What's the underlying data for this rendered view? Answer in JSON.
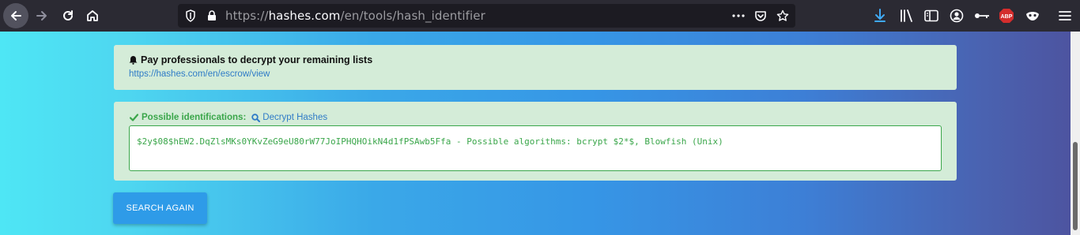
{
  "browser": {
    "url_scheme": "https://",
    "url_host": "hashes.com",
    "url_path": "/en/tools/hash_identifier",
    "icons": {
      "back": "arrow-left-icon",
      "forward": "arrow-right-icon",
      "reload": "reload-icon",
      "home": "home-icon",
      "tracking": "shield-icon",
      "lock": "lock-icon",
      "more": "more-icon",
      "pocket": "pocket-icon",
      "bookmark": "star-icon",
      "downloads": "download-icon",
      "library": "library-icon",
      "sidebar": "sidebar-icon",
      "account": "account-icon",
      "extension": "extension-key-icon",
      "adblock": "abp-icon",
      "extension2": "mask-icon",
      "menu": "hamburger-menu-icon"
    },
    "adblock_label": "ABP"
  },
  "escrow": {
    "title": "Pay professionals to decrypt your remaining lists",
    "link": "https://hashes.com/en/escrow/view"
  },
  "identification": {
    "label": "Possible identifications:",
    "decrypt_link": "Decrypt Hashes",
    "result": "$2y$08$hEW2.DqZlsMKs0YKvZeG9eU80rW77JoIPHQHOikN4d1fPSAwb5Ffa - Possible algorithms: bcrypt $2*$, Blowfish (Unix)"
  },
  "search_again_label": "SEARCH AGAIN",
  "colors": {
    "toolbar": "#2b2a33",
    "urlbar": "#1c1b22",
    "card_bg": "#d4ecd8",
    "success": "#3aa64a",
    "link": "#2f7bc7",
    "button": "#2e9be8"
  }
}
